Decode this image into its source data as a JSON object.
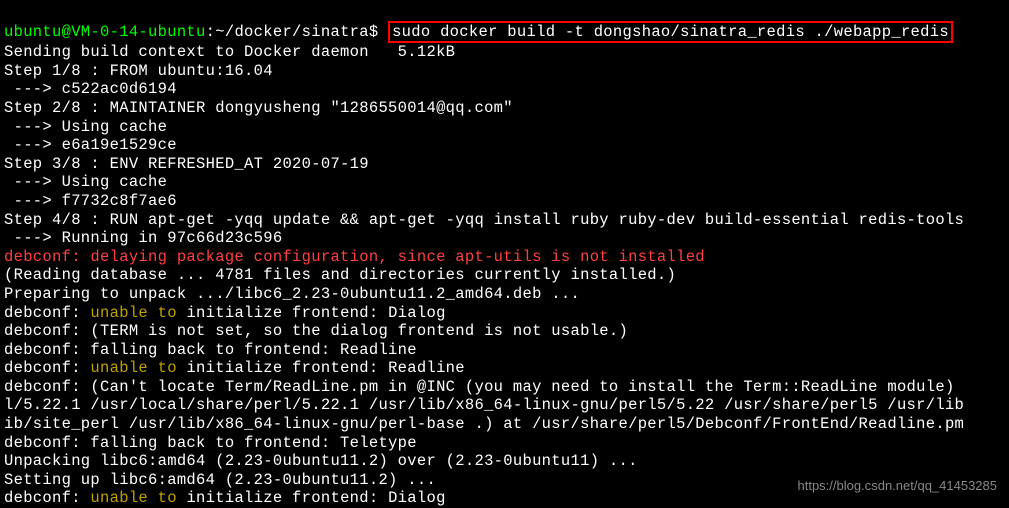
{
  "prompt": {
    "user_host": "ubuntu@VM-0-14-ubuntu",
    "separator": ":",
    "path": "~/docker/sinatra",
    "symbol": "$ "
  },
  "command": "sudo docker build -t dongshao/sinatra_redis ./webapp_redis",
  "lines": {
    "l1": "Sending build context to Docker daemon   5.12kB",
    "l2": "Step 1/8 : FROM ubuntu:16.04",
    "l3": " ---> c522ac0d6194",
    "l4": "Step 2/8 : MAINTAINER dongyusheng \"1286550014@qq.com\"",
    "l5": " ---> Using cache",
    "l6": " ---> e6a19e1529ce",
    "l7": "Step 3/8 : ENV REFRESHED_AT 2020-07-19",
    "l8": " ---> Using cache",
    "l9": " ---> f7732c8f7ae6",
    "l10": "Step 4/8 : RUN apt-get -yqq update && apt-get -yqq install ruby ruby-dev build-essential redis-tools",
    "l11": " ---> Running in 97c66d23c596",
    "l12": "debconf: delaying package configuration, since apt-utils is not installed",
    "l13": "(Reading database ... 4781 files and directories currently installed.)",
    "l14": "Preparing to unpack .../libc6_2.23-0ubuntu11.2_amd64.deb ...",
    "l15a": "debconf: ",
    "l15b": "unable to",
    "l15c": " initialize frontend: Dialog",
    "l16": "debconf: (TERM is not set, so the dialog frontend is not usable.)",
    "l17": "debconf: falling back to frontend: Readline",
    "l18a": "debconf: ",
    "l18b": "unable to",
    "l18c": " initialize frontend: Readline",
    "l19": "debconf: (Can't locate Term/ReadLine.pm in @INC (you may need to install the Term::ReadLine module)",
    "l20": "l/5.22.1 /usr/local/share/perl/5.22.1 /usr/lib/x86_64-linux-gnu/perl5/5.22 /usr/share/perl5 /usr/lib",
    "l21": "ib/site_perl /usr/lib/x86_64-linux-gnu/perl-base .) at /usr/share/perl5/Debconf/FrontEnd/Readline.pm",
    "l22": "debconf: falling back to frontend: Teletype",
    "l23": "Unpacking libc6:amd64 (2.23-0ubuntu11.2) over (2.23-0ubuntu11) ...",
    "l24": "Setting up libc6:amd64 (2.23-0ubuntu11.2) ...",
    "l25a": "debconf: ",
    "l25b": "unable to",
    "l25c": " initialize frontend: Dialog"
  },
  "watermark": "https://blog.csdn.net/qq_41453285"
}
